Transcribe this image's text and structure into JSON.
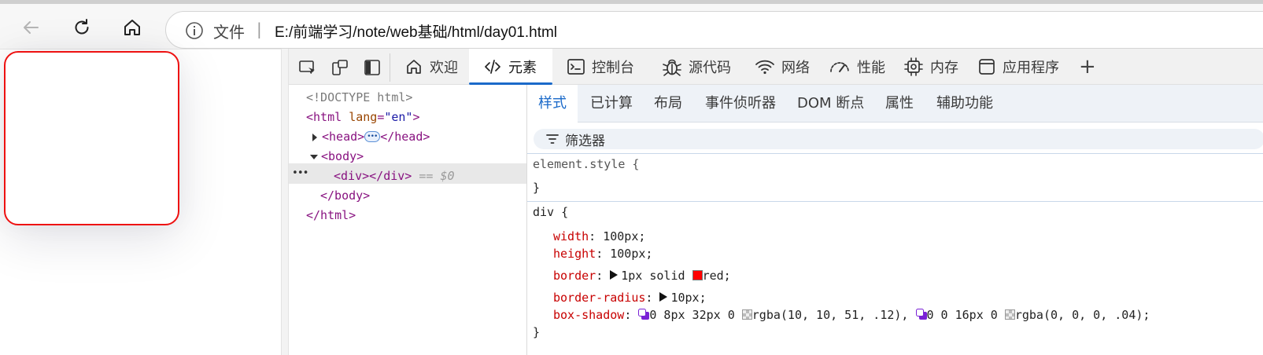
{
  "browser": {
    "address": {
      "label": "文件",
      "url": "E:/前端学习/note/web基础/html/day01.html"
    }
  },
  "devtools": {
    "tabs": [
      {
        "label": "欢迎",
        "icon": "home-icon"
      },
      {
        "label": "元素",
        "icon": "code-icon"
      },
      {
        "label": "控制台",
        "icon": "console-icon"
      },
      {
        "label": "源代码",
        "icon": "bug-icon"
      },
      {
        "label": "网络",
        "icon": "wifi-icon"
      },
      {
        "label": "性能",
        "icon": "gauge-icon"
      },
      {
        "label": "内存",
        "icon": "chip-icon"
      },
      {
        "label": "应用程序",
        "icon": "window-icon"
      }
    ],
    "add_tab_symbol": "+",
    "dom": {
      "doctype": "<!DOCTYPE html>",
      "html_open": "<html",
      "lang_attr": "lang",
      "lang_val": "\"en\"",
      "gt": ">",
      "head_open": "<head>",
      "head_close": "</head>",
      "body_open": "<body>",
      "div": "<div></div>",
      "eq0": "== $0",
      "body_close": "</body>",
      "html_close": "</html>",
      "row_menu": "•••"
    },
    "styles_tabs": [
      "样式",
      "已计算",
      "布局",
      "事件侦听器",
      "DOM 断点",
      "属性",
      "辅助功能"
    ],
    "filter_placeholder": "筛选器",
    "rules": {
      "element_style_selector": "element.style {",
      "close_brace": "}",
      "div_selector": "div {",
      "props": {
        "width_name": "width",
        "width_value": "100px;",
        "height_name": "height",
        "height_value": "100px;",
        "border_name": "border",
        "border_value_a": "1px solid",
        "border_value_b": "red;",
        "radius_name": "border-radius",
        "radius_value": "10px;",
        "shadow_name": "box-shadow",
        "shadow_value_a": "0 8px 32px 0",
        "shadow_color_a": "rgba(10, 10, 51, .12),",
        "shadow_value_b": "0 0 16px 0",
        "shadow_color_b": "rgba(0, 0, 0, .04);"
      },
      "colon": ":"
    },
    "colors": {
      "accent": "#1b6ac9",
      "tag": "#881280",
      "prop": "#c80000",
      "border_red": "#ff0000"
    }
  }
}
